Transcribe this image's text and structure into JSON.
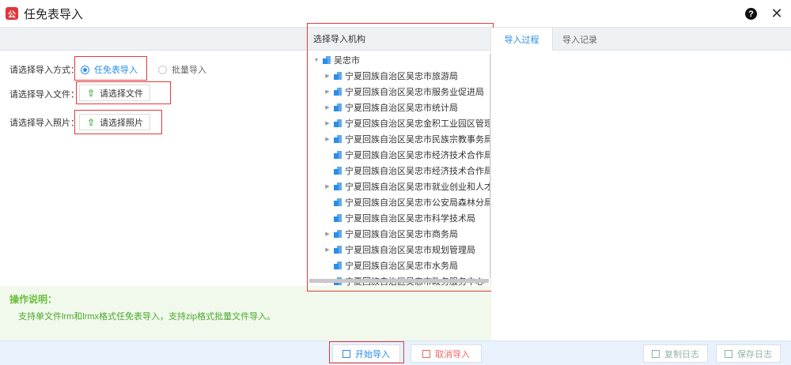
{
  "window": {
    "title": "任免表导入",
    "app_icon_glyph": "公",
    "help_glyph": "?",
    "close_glyph": "✕"
  },
  "form": {
    "mode_label": "请选择导入方式：",
    "mode_options": [
      "任免表导入",
      "批量导入"
    ],
    "mode_selected": "任免表导入",
    "file_label": "请选择导入文件：",
    "file_button": "请选择文件",
    "photo_label": "请选择导入照片：",
    "photo_button": "请选择照片"
  },
  "instructions": {
    "title": "操作说明：",
    "text": "支持单文件lrm和lrmx格式任免表导入，支持zip格式批量文件导入。"
  },
  "tree": {
    "header": "选择导入机构",
    "root": "吴忠市",
    "children": [
      {
        "label": "宁夏回族自治区吴忠市旅游局",
        "expandable": true
      },
      {
        "label": "宁夏回族自治区吴忠市服务业促进局",
        "expandable": true
      },
      {
        "label": "宁夏回族自治区吴忠市统计局",
        "expandable": true
      },
      {
        "label": "宁夏回族自治区吴忠金积工业园区管理",
        "expandable": true
      },
      {
        "label": "宁夏回族自治区吴忠市民族宗教事务局",
        "expandable": true
      },
      {
        "label": "宁夏回族自治区吴忠市经济技术合作局",
        "expandable": false
      },
      {
        "label": "宁夏回族自治区吴忠市经济技术合作局",
        "expandable": false
      },
      {
        "label": "宁夏回族自治区吴忠市就业创业和人才",
        "expandable": true
      },
      {
        "label": "宁夏回族自治区吴忠市公安局森林分局",
        "expandable": false
      },
      {
        "label": "宁夏回族自治区吴忠市科学技术局",
        "expandable": false
      },
      {
        "label": "宁夏回族自治区吴忠市商务局",
        "expandable": true
      },
      {
        "label": "宁夏回族自治区吴忠市规划管理局",
        "expandable": true
      },
      {
        "label": "宁夏回族自治区吴忠市水务局",
        "expandable": false
      },
      {
        "label": "宁夏回族自治区吴忠市政务服务中心",
        "expandable": true
      }
    ]
  },
  "tabs": [
    {
      "label": "导入过程",
      "active": true
    },
    {
      "label": "导入记录",
      "active": false
    }
  ],
  "footer": {
    "start_button": "开始导入",
    "cancel_button": "取消导入",
    "copy_log_button": "复制日志",
    "save_log_button": "保存日志"
  },
  "colors": {
    "accent": "#2a8ee8",
    "highlight_box": "#e23a3a",
    "instructions_bg": "#f0f9eb",
    "instructions_text": "#4aa82b"
  }
}
